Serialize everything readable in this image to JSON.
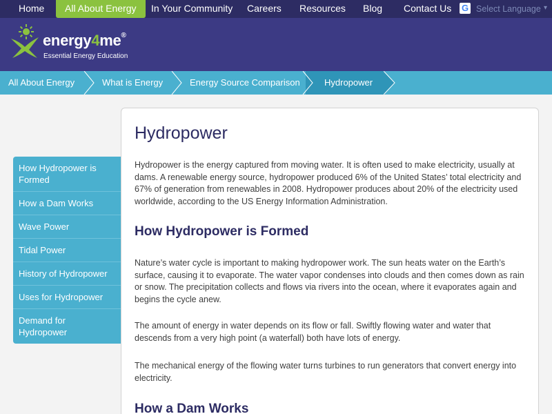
{
  "topnav": {
    "items": [
      "Home",
      "All About Energy",
      "In Your Community",
      "Careers",
      "Resources",
      "Blog",
      "Contact Us"
    ],
    "active_index": 1,
    "language_label": "Select Language"
  },
  "header": {
    "logo_prefix": "energy",
    "logo_four": "4",
    "logo_suffix": "me",
    "logo_reg": "®",
    "tagline": "Essential Energy Education"
  },
  "breadcrumb": [
    "All About Energy",
    "What is Energy",
    "Energy Source Comparison",
    "Hydropower"
  ],
  "sidebar": {
    "items": [
      "How Hydropower is Formed",
      "How a Dam Works",
      "Wave Power",
      "Tidal Power",
      "History of Hydropower",
      "Uses for Hydropower",
      "Demand for Hydropower"
    ]
  },
  "content": {
    "title": "Hydropower",
    "intro": "Hydropower is the energy captured from moving water. It is often used to make electricity, usually at dams. A renewable energy source, hydropower produced 6% of the United States’ total electricity and 67% of generation from renewables in 2008. Hydropower produces about 20% of the electricity used worldwide, according to the US Energy Information Administration.",
    "section1_heading": "How Hydropower is Formed",
    "section1_p1": "Nature’s water cycle is important to making hydropower work. The sun heats water on the Earth’s surface, causing it to evaporate. The water vapor condenses into clouds and then comes down as rain or snow. The precipitation collects and flows via rivers into the ocean, where it evaporates again and begins the cycle anew.",
    "section1_p2": "The amount of energy in water depends on its flow or fall. Swiftly flowing water and water that descends from a very high point (a waterfall) both have lots of energy.",
    "section1_p3": "The mechanical energy of the flowing water turns turbines to run generators that convert energy into electricity.",
    "section2_heading": "How a Dam Works"
  },
  "colors": {
    "nav_bg": "#2d2c63",
    "header_bg": "#3c3a84",
    "active_green": "#8bc23f",
    "accent_blue": "#4ab0cf",
    "heading_navy": "#2d2c63"
  }
}
